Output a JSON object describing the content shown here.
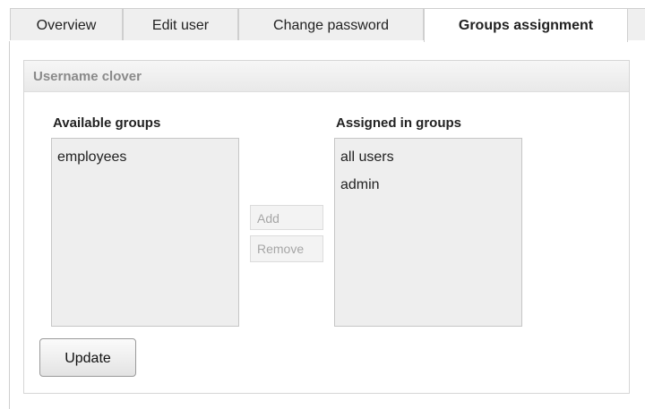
{
  "tabs": [
    {
      "label": "Overview",
      "active": false
    },
    {
      "label": "Edit user",
      "active": false
    },
    {
      "label": "Change password",
      "active": false
    },
    {
      "label": "Groups assignment",
      "active": true
    }
  ],
  "panel": {
    "title": "Username clover"
  },
  "available": {
    "label": "Available groups",
    "options": [
      "employees"
    ]
  },
  "assigned": {
    "label": "Assigned in groups",
    "options": [
      "all users",
      "admin"
    ]
  },
  "buttons": {
    "add": "Add",
    "remove": "Remove",
    "update": "Update"
  },
  "colors": {
    "tab_background": "#efefef",
    "active_tab_background": "#ffffff",
    "listbox_background": "#eeeeee",
    "header_text": "#8a8a8a",
    "disabled_button_text": "#a6a6a6"
  }
}
